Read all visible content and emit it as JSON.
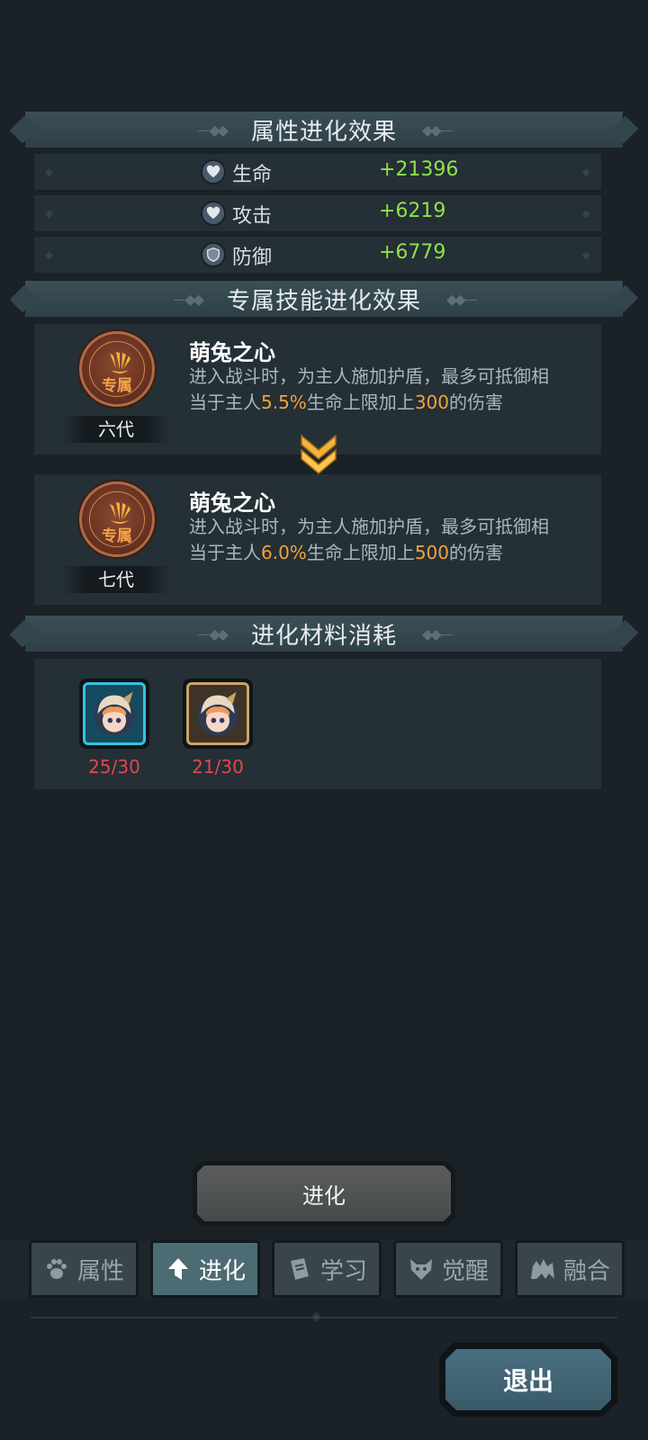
{
  "sections": {
    "attribute_title": "属性进化效果",
    "skill_title": "专属技能进化效果",
    "materials_title": "进化材料消耗"
  },
  "stats": [
    {
      "label": "生命",
      "value": "+21396",
      "icon": "heart-shield-icon"
    },
    {
      "label": "攻击",
      "value": "+6219",
      "icon": "heart-shield-icon"
    },
    {
      "label": "防御",
      "value": "+6779",
      "icon": "shield-icon"
    }
  ],
  "skills": [
    {
      "badge": "专属",
      "generation": "六代",
      "name": "萌兔之心",
      "desc_line1": "进入战斗时，为主人施加护盾，最多可抵御相",
      "desc_pre": "当于主人",
      "desc_pct": "5.5%",
      "desc_mid": "生命上限加上",
      "desc_num": "300",
      "desc_post": "的伤害"
    },
    {
      "badge": "专属",
      "generation": "七代",
      "name": "萌兔之心",
      "desc_line1": "进入战斗时，为主人施加护盾，最多可抵御相",
      "desc_pre": "当于主人",
      "desc_pct": "6.0%",
      "desc_mid": "生命上限加上",
      "desc_num": "500",
      "desc_post": "的伤害"
    }
  ],
  "materials": [
    {
      "count": "25/30",
      "frame": "blue"
    },
    {
      "count": "21/30",
      "frame": "gold"
    }
  ],
  "evolve_button": "进化",
  "tabs": [
    {
      "label": "属性",
      "icon": "paw-icon",
      "active": false
    },
    {
      "label": "进化",
      "icon": "arrow-up-icon",
      "active": true
    },
    {
      "label": "学习",
      "icon": "book-icon",
      "active": false
    },
    {
      "label": "觉醒",
      "icon": "wolf-icon",
      "active": false
    },
    {
      "label": "融合",
      "icon": "beast-icon",
      "active": false
    }
  ],
  "exit_button": "退出",
  "colors": {
    "background": "#1a2127",
    "stat_value": "#8fe24a",
    "highlight": "#f2a33a",
    "insufficient": "#e24848"
  }
}
